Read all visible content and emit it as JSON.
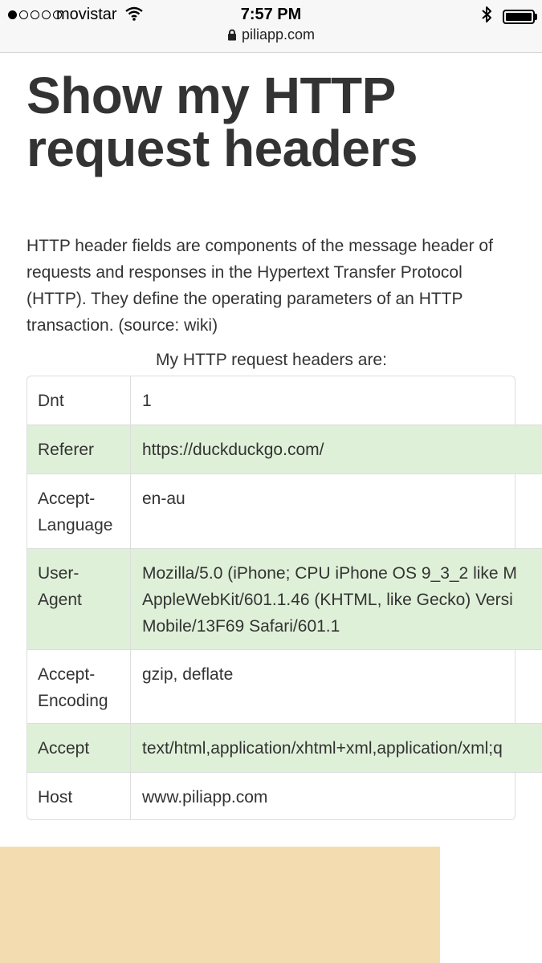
{
  "status_bar": {
    "carrier": "movistar",
    "time": "7:57 PM",
    "signal_bars_filled": 1,
    "signal_bars_total": 5,
    "battery_level": 1.0
  },
  "browser": {
    "address": "piliapp.com"
  },
  "page": {
    "title": "Show my HTTP request headers",
    "intro": "HTTP header fields are components of the message header of requests and responses in the Hypertext Transfer Protocol (HTTP). They define the operating parameters of an HTTP transaction. (source: wiki)",
    "table_caption": "My HTTP request headers are:",
    "headers": [
      {
        "name": "Dnt",
        "value": "1"
      },
      {
        "name": "Referer",
        "value": "https://duckduckgo.com/"
      },
      {
        "name": "Accept-\nLanguage",
        "value": "en-au"
      },
      {
        "name": "User-\nAgent",
        "value": "Mozilla/5.0 (iPhone; CPU iPhone OS 9_3_2 like M\nAppleWebKit/601.1.46 (KHTML, like Gecko) Versi\nMobile/13F69 Safari/601.1"
      },
      {
        "name": "Accept-\nEncoding",
        "value": "gzip, deflate"
      },
      {
        "name": "Accept",
        "value": "text/html,application/xhtml+xml,application/xml;q"
      },
      {
        "name": "Host",
        "value": "www.piliapp.com"
      }
    ]
  },
  "colors": {
    "row_highlight": "#dff0d8",
    "ad_background": "#f3ddb0",
    "text": "#333333"
  }
}
